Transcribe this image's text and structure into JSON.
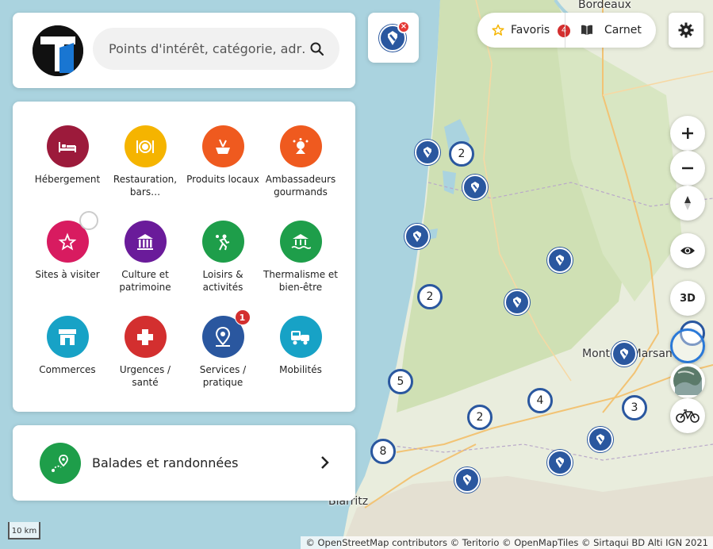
{
  "search": {
    "placeholder": "Points d'intérêt, catégorie, adr…"
  },
  "header": {
    "favorites_label": "Favoris",
    "favorites_count": "4",
    "carnet_label": "Carnet",
    "filter_close": "×"
  },
  "categories": [
    {
      "label": "Hébergement",
      "color": "#9c1a3b",
      "icon": "bed-icon"
    },
    {
      "label": "Restauration, bars…",
      "color": "#f5b400",
      "icon": "plate-icon"
    },
    {
      "label": "Produits locaux",
      "color": "#ef5a1f",
      "icon": "basket-icon"
    },
    {
      "label": "Ambassadeurs gourmands",
      "color": "#ef5a1f",
      "icon": "chef-icon"
    },
    {
      "label": "Sites à visiter",
      "color": "#d81b60",
      "icon": "star-icon"
    },
    {
      "label": "Culture et patrimoine",
      "color": "#6a1b9a",
      "icon": "monument-icon"
    },
    {
      "label": "Loisirs & activités",
      "color": "#1e9e4a",
      "icon": "activity-icon"
    },
    {
      "label": "Thermalisme et bien-être",
      "color": "#1e9e4a",
      "icon": "spa-icon"
    },
    {
      "label": "Commerces",
      "color": "#17a2c6",
      "icon": "shop-icon"
    },
    {
      "label": "Urgences / santé",
      "color": "#d32f2f",
      "icon": "cross-icon"
    },
    {
      "label": "Services / pratique",
      "color": "#2a579f",
      "icon": "pin-icon",
      "badge": "1"
    },
    {
      "label": "Mobilités",
      "color": "#17a2c6",
      "icon": "vehicle-icon"
    }
  ],
  "walks": {
    "label": "Balades et randonnées"
  },
  "controls": {
    "zoom_in": "+",
    "zoom_out": "−",
    "compass": "▲",
    "three_d": "3D"
  },
  "map": {
    "labels": [
      "Bordeaux",
      "Mont-de-Marsan",
      "Biarritz"
    ],
    "clusters": [
      "2",
      "2",
      "5",
      "4",
      "2",
      "3",
      "8"
    ],
    "scale": "10 km",
    "attribution": "© OpenStreetMap contributors © Teritorio © OpenMapTiles © Sirtaqui BD Alti IGN 2021"
  }
}
